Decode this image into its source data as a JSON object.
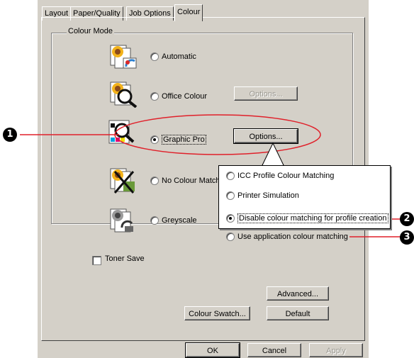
{
  "tabs": [
    {
      "label": "Layout"
    },
    {
      "label": "Paper/Quality"
    },
    {
      "label": "Job Options"
    },
    {
      "label": "Colour",
      "active": true
    }
  ],
  "colour_mode": {
    "group_label": "Colour Mode",
    "options": [
      {
        "label": "Automatic",
        "checked": false,
        "icon": "automatic-colour-icon"
      },
      {
        "label": "Office Colour",
        "checked": false,
        "icon": "office-colour-icon",
        "options_button": "Options...",
        "options_enabled": false
      },
      {
        "label": "Graphic Pro",
        "checked": true,
        "icon": "graphic-pro-icon",
        "options_button": "Options...",
        "options_enabled": true
      },
      {
        "label": "No Colour Match",
        "checked": false,
        "icon": "no-colour-match-icon"
      },
      {
        "label": "Greyscale",
        "checked": false,
        "icon": "greyscale-icon"
      }
    ]
  },
  "toner_save": {
    "label": "Toner Save",
    "checked": false
  },
  "buttons": {
    "advanced": "Advanced...",
    "colour_swatch": "Colour Swatch...",
    "default": "Default",
    "ok": "OK",
    "cancel": "Cancel",
    "apply": "Apply"
  },
  "popup": {
    "options": [
      {
        "label": "ICC Profile Colour Matching",
        "checked": false
      },
      {
        "label": "Printer Simulation",
        "checked": false
      },
      {
        "label": "Disable colour matching for profile creation",
        "checked": true
      },
      {
        "label": "Use application colour matching",
        "checked": false
      }
    ]
  },
  "callouts": [
    "1",
    "2",
    "3"
  ],
  "colors": {
    "dialog_bg": "#d4d0c8",
    "annotation_red": "#e0202a",
    "callout_black": "#000000"
  }
}
